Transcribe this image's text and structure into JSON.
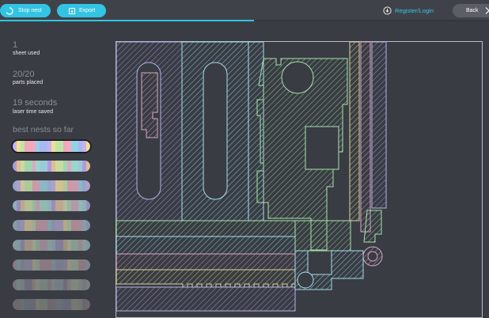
{
  "toolbar": {
    "stop_label": "Stop nest",
    "export_label": "Export",
    "register_label": "Register/Login",
    "back_label": "Back",
    "progress_fraction": 0.52,
    "accent_color": "#33c3e3"
  },
  "stats": {
    "sheets_value": "1",
    "sheets_label": "sheet used",
    "parts_value": "20/20",
    "parts_label": "parts placed",
    "time_value": "19 seconds",
    "time_label": "laser time saved"
  },
  "best_nests": {
    "title": "best nests so far",
    "selected_index": 0,
    "count": 9,
    "palette": [
      "#c6b3f0",
      "#9fd8ea",
      "#f1a9c6",
      "#a9e3b4",
      "#f3dd94",
      "#b9a5ef",
      "#94d2e6",
      "#e9b2d2",
      "#bde6a6",
      "#f5c69a",
      "#a8b8f0",
      "#9fe5d4",
      "#f0a9b8",
      "#d6eaa0"
    ]
  },
  "icons": {
    "stop": "loading-spinner-icon",
    "export": "export-icon",
    "register": "download-circle-icon",
    "back": "chevron-right-icon"
  }
}
